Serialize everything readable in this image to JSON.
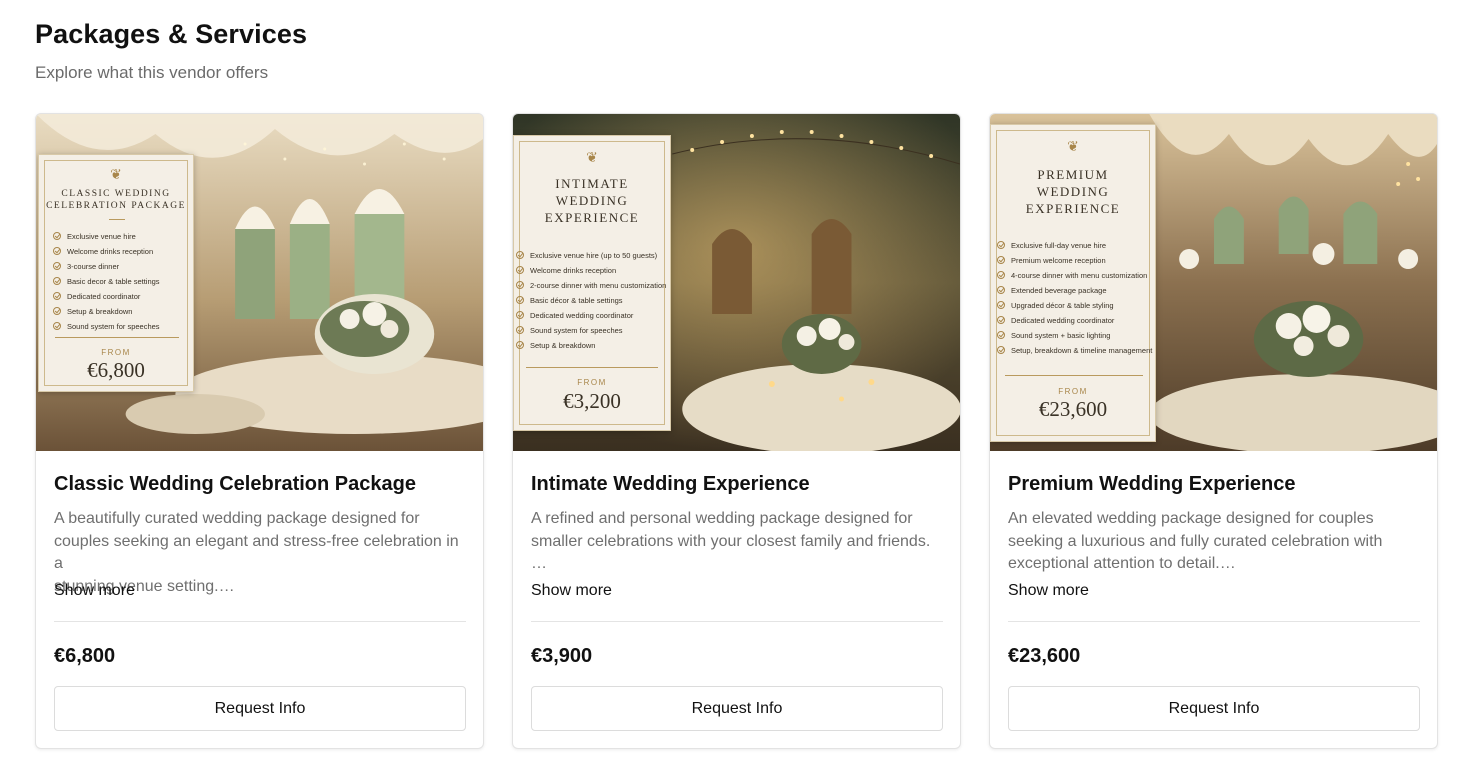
{
  "section": {
    "title": "Packages & Services",
    "subtitle": "Explore what this vendor offers"
  },
  "packages": [
    {
      "title": "Classic Wedding Celebration Package",
      "description_lines": [
        "A beautifully curated wedding package designed for",
        "couples seeking an elegant and stress-free celebration in a",
        "stunning venue setting.…"
      ],
      "show_more_label": "Show more",
      "price": "€6,800",
      "button_label": "Request Info",
      "image": {
        "menu_title_lines": [
          "Classic Wedding",
          "Celebration Package"
        ],
        "menu_items": [
          "Exclusive venue hire",
          "Welcome drinks reception",
          "3-course dinner",
          "Basic decor & table settings",
          "Dedicated coordinator",
          "Setup & breakdown",
          "Sound system for speeches"
        ],
        "from_label": "FROM",
        "menu_price": "€6,800"
      }
    },
    {
      "title": "Intimate Wedding Experience",
      "description_lines": [
        "A refined and personal wedding package designed for",
        "smaller celebrations with your closest family and friends.",
        "…"
      ],
      "show_more_label": "Show more",
      "price": "€3,900",
      "button_label": "Request Info",
      "image": {
        "menu_title_lines": [
          "Intimate",
          "Wedding",
          "Experience"
        ],
        "menu_items": [
          "Exclusive venue hire (up to 50 guests)",
          "Welcome drinks reception",
          "2-course dinner with menu customization",
          "Basic décor & table settings",
          "Dedicated wedding coordinator",
          "Sound system for speeches",
          "Setup & breakdown"
        ],
        "from_label": "FROM",
        "menu_price": "€3,200"
      }
    },
    {
      "title": "Premium Wedding Experience",
      "description_lines": [
        "An elevated wedding package designed for couples",
        "seeking a luxurious and fully curated celebration with",
        "exceptional attention to detail.…"
      ],
      "show_more_label": "Show more",
      "price": "€23,600",
      "button_label": "Request Info",
      "image": {
        "menu_title_lines": [
          "Premium",
          "Wedding",
          "Experience"
        ],
        "menu_items": [
          "Exclusive full-day venue hire",
          "Premium welcome reception",
          "4-course dinner with menu customization",
          "Extended beverage package",
          "Upgraded décor & table styling",
          "Dedicated wedding coordinator",
          "Sound system + basic lighting",
          "Setup, breakdown & timeline management"
        ],
        "from_label": "FROM",
        "menu_price": "€23,600"
      }
    }
  ],
  "colors": {
    "gold": "#a8864a",
    "card_border": "#e3e3e3",
    "muted_text": "#6f6f6f"
  }
}
